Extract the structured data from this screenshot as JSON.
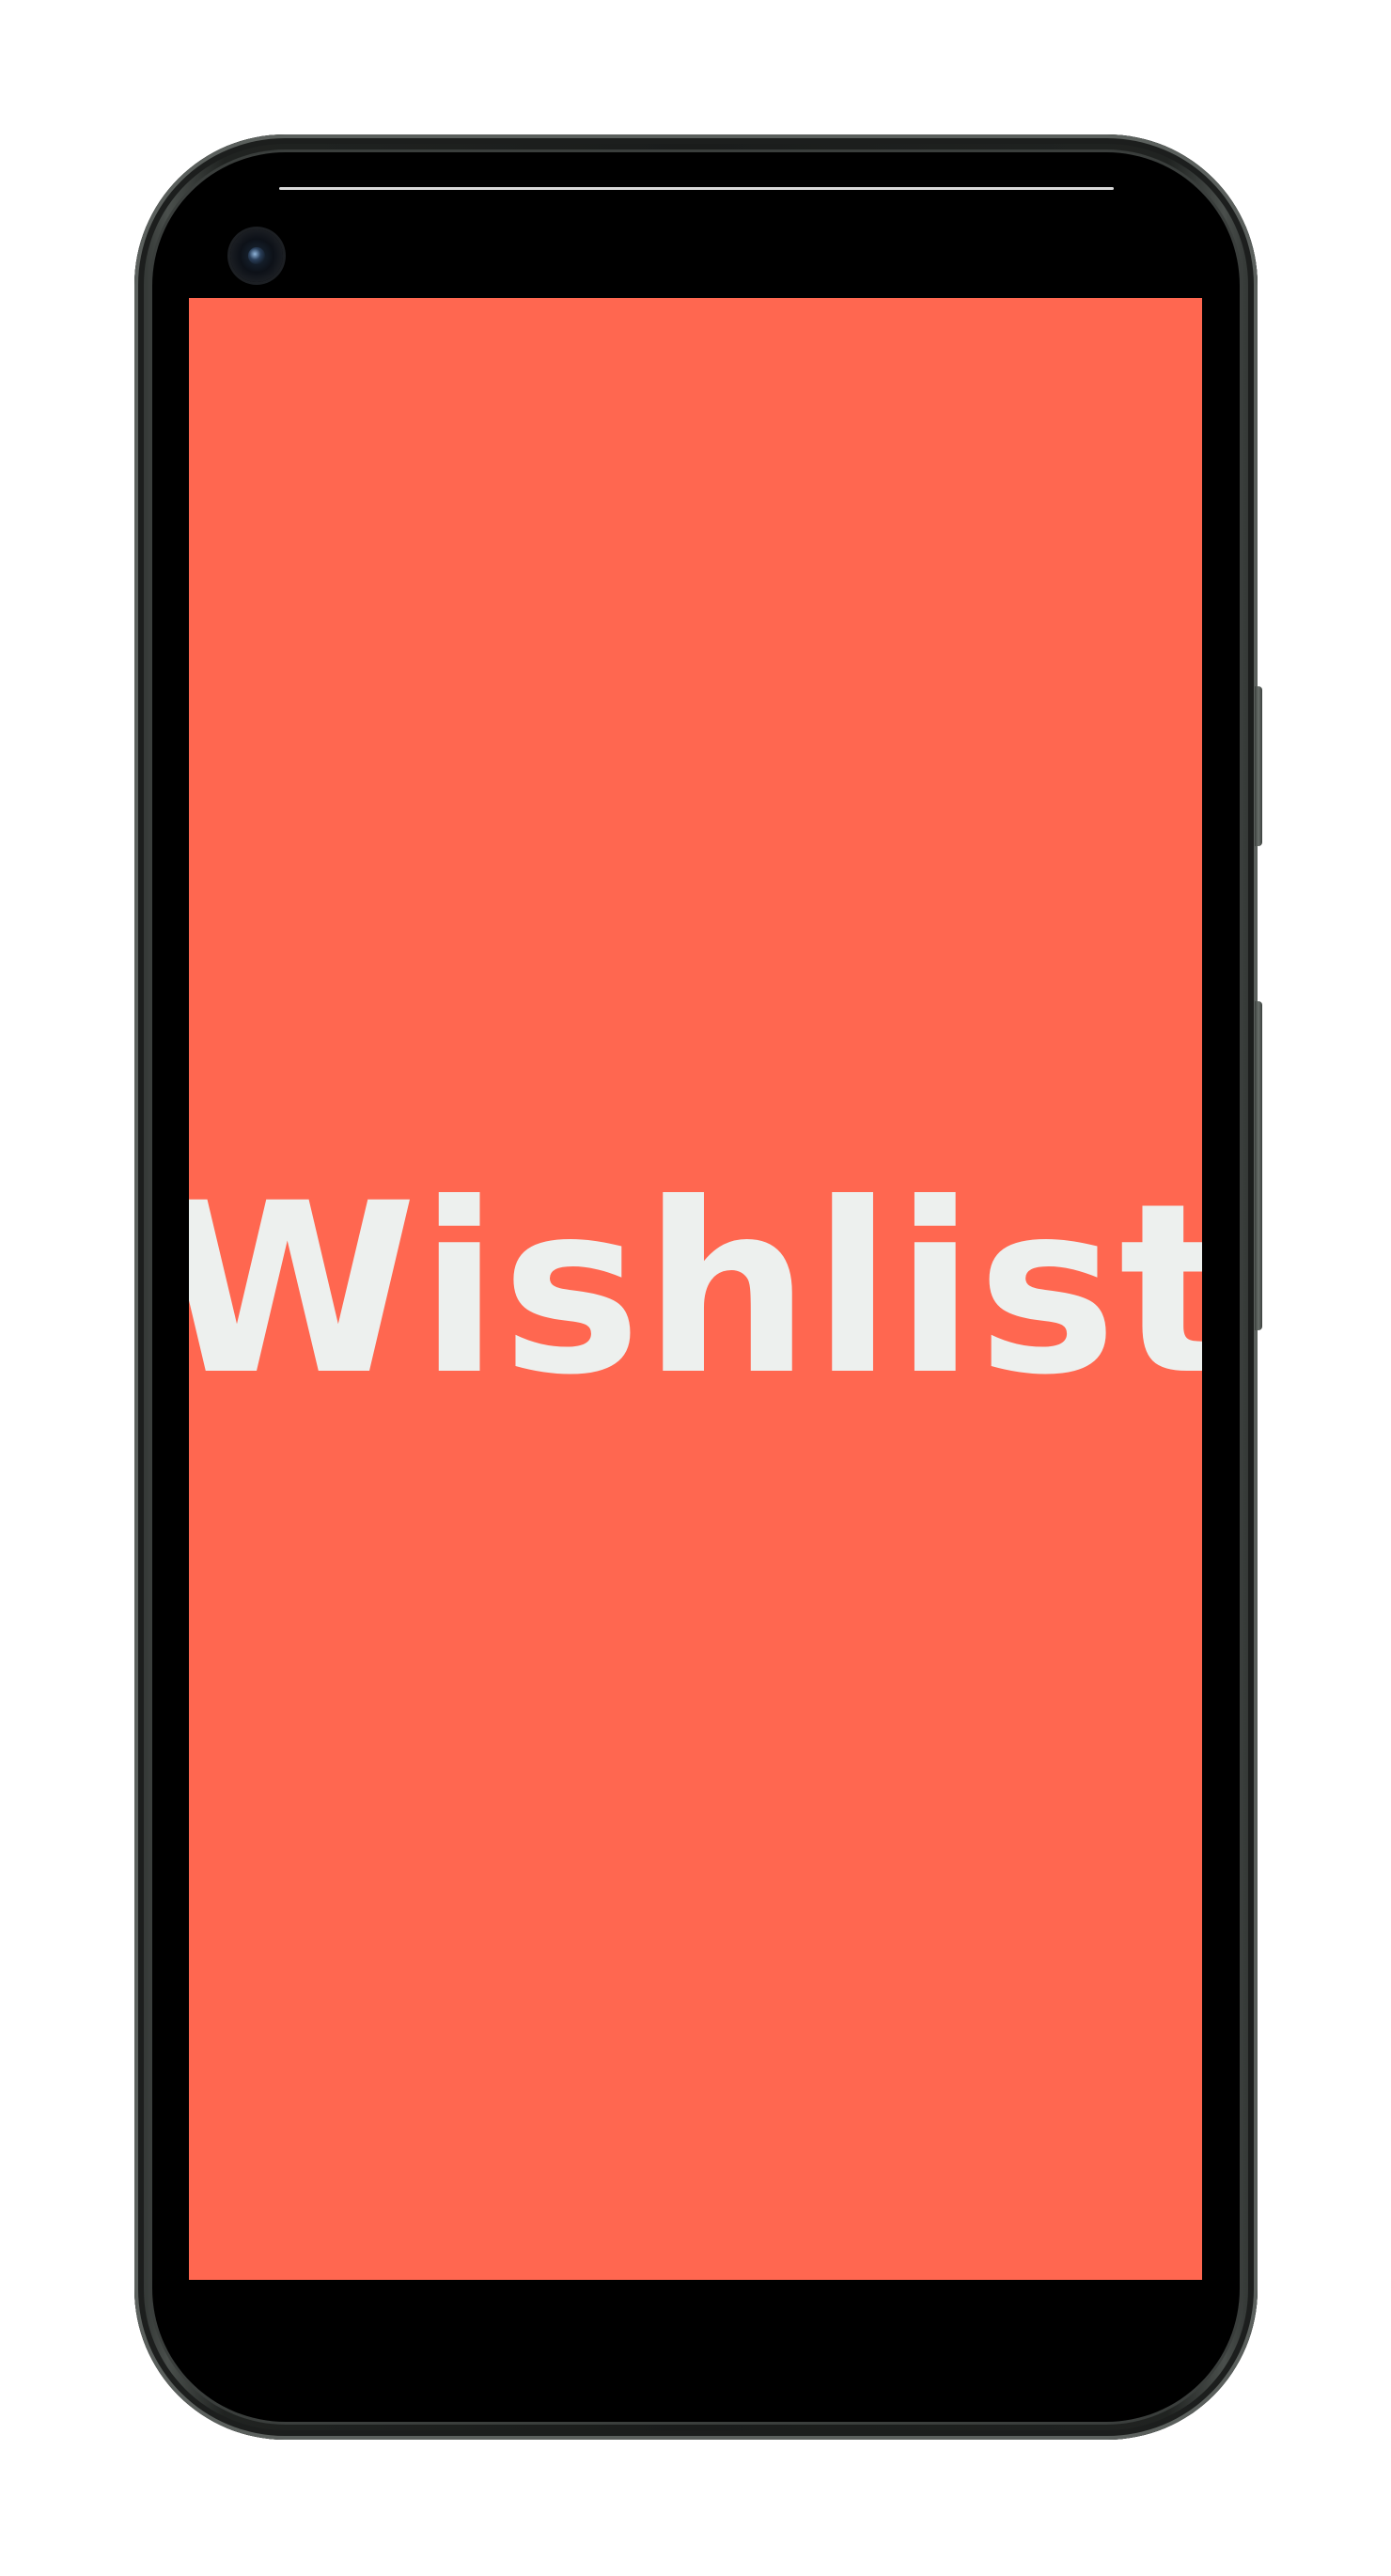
{
  "app": {
    "splash_title": "Wishlist"
  },
  "colors": {
    "splash_background": "#FF6750",
    "title_text": "#EDF0EE",
    "device_frame": "#1A1C1B",
    "screen_bezel": "#000000"
  },
  "icons": {
    "front_camera": "camera-icon"
  }
}
